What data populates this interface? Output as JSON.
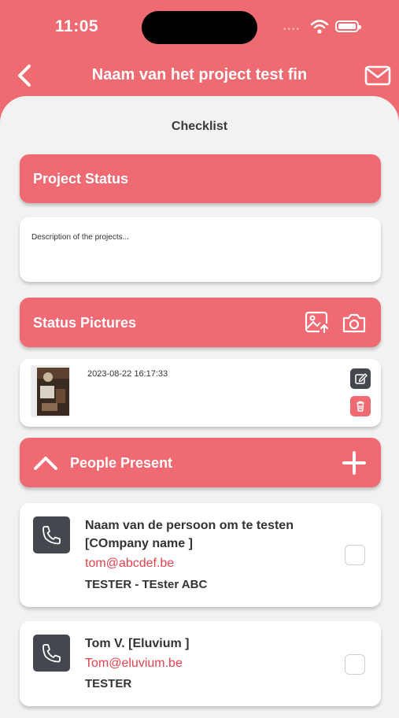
{
  "status_bar": {
    "time": "11:05"
  },
  "nav": {
    "title": "Naam van het project test fin"
  },
  "page": {
    "title": "Checklist"
  },
  "project_status": {
    "label": "Project Status",
    "description_placeholder": "Description of the projects..."
  },
  "status_pictures": {
    "label": "Status Pictures",
    "items": [
      {
        "timestamp": "2023-08-22 16:17:33"
      }
    ]
  },
  "people_present": {
    "label": "People Present",
    "people": [
      {
        "name_line1": "Naam van de persoon om te testen",
        "name_line2": "[COmpany name ]",
        "email": "tom@abcdef.be",
        "role": "TESTER - TEster ABC"
      },
      {
        "name_line1": "Tom V. [Eluvium ]",
        "email": "Tom@eluvium.be",
        "role": "TESTER"
      }
    ]
  },
  "colors": {
    "accent": "#ef6a72",
    "email": "#e2424e",
    "dark_button": "#44474d",
    "delete": "#ef6a72"
  }
}
